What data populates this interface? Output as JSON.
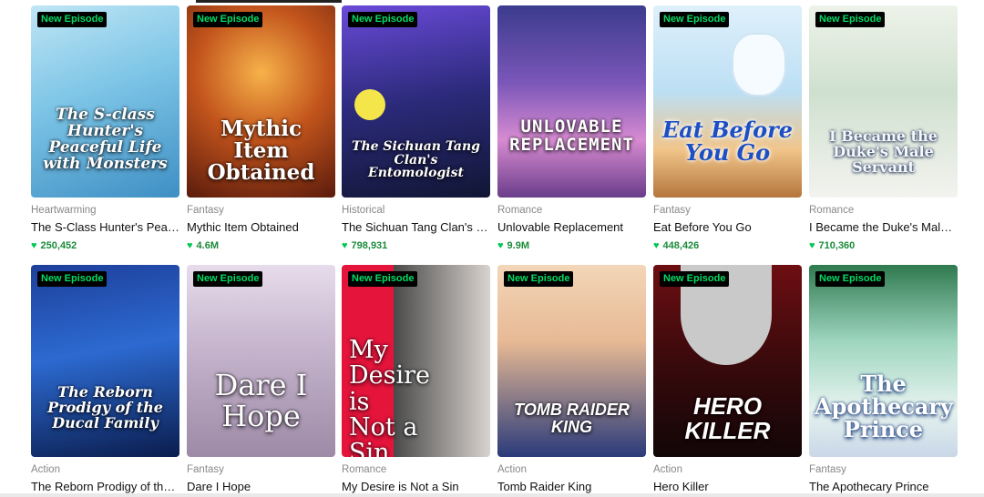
{
  "badge_label": "New Episode",
  "colors": {
    "accent_green": "#00dc64",
    "like_green": "#1a8a3a"
  },
  "cards": [
    {
      "cover_title": "The S-class Hunter's Peaceful Life with Monsters",
      "genre": "Heartwarming",
      "title": "The S-Class Hunter's Peac...",
      "likes": "250,452"
    },
    {
      "cover_title": "Mythic Item Obtained",
      "genre": "Fantasy",
      "title": "Mythic Item Obtained",
      "likes": "4.6M"
    },
    {
      "cover_title": "The Sichuan Tang Clan's Entomologist",
      "genre": "Historical",
      "title": "The Sichuan Tang Clan's E...",
      "likes": "798,931"
    },
    {
      "cover_title": "UNLOVABLE REPLACEMENT",
      "genre": "Romance",
      "title": "Unlovable Replacement",
      "likes": "9.9M"
    },
    {
      "cover_title": "Eat Before You Go",
      "genre": "Fantasy",
      "title": "Eat Before You Go",
      "likes": "448,426"
    },
    {
      "cover_title": "I Became the Duke's Male Servant",
      "genre": "Romance",
      "title": "I Became the Duke's Male ...",
      "likes": "710,360"
    },
    {
      "cover_title": "The Reborn Prodigy of the Ducal Family",
      "genre": "Action",
      "title": "The Reborn Prodigy of the...",
      "likes": ""
    },
    {
      "cover_title": "Dare I Hope",
      "genre": "Fantasy",
      "title": "Dare I Hope",
      "likes": ""
    },
    {
      "cover_title": "My Desire is Not a Sin",
      "genre": "Romance",
      "title": "My Desire is Not a Sin",
      "likes": ""
    },
    {
      "cover_title": "TOMB RAIDER KING",
      "genre": "Action",
      "title": "Tomb Raider King",
      "likes": ""
    },
    {
      "cover_title": "HERO KILLER",
      "genre": "Action",
      "title": "Hero Killer",
      "likes": ""
    },
    {
      "cover_title": "The Apothecary Prince",
      "genre": "Fantasy",
      "title": "The Apothecary Prince",
      "likes": ""
    }
  ]
}
